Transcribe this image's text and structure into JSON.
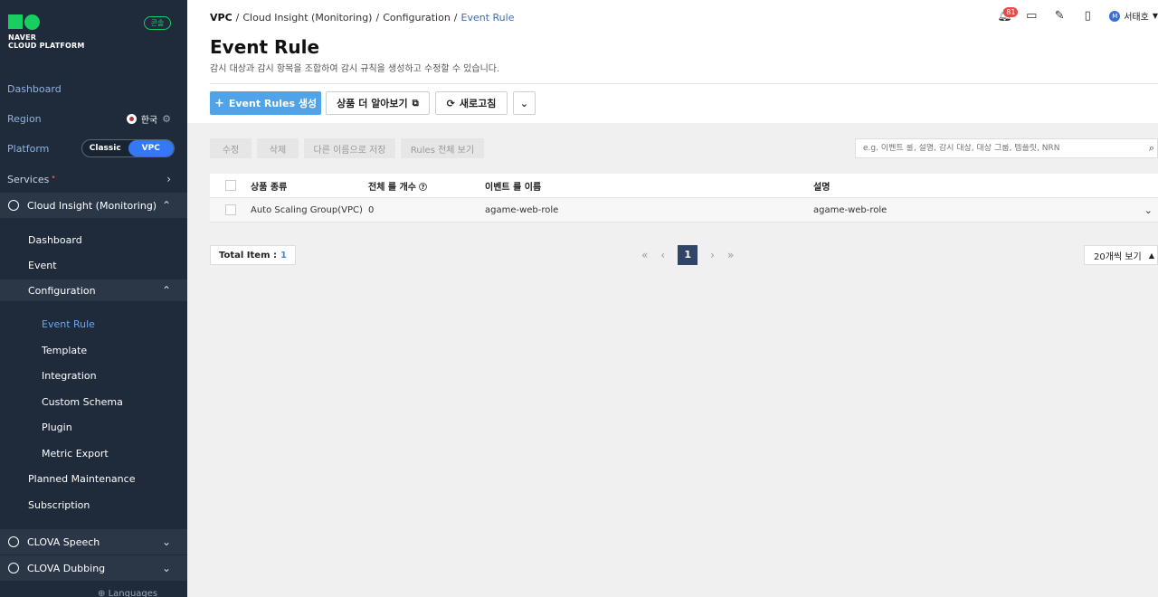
{
  "sidebar": {
    "logo_line1": "NAVER",
    "logo_line2": "CLOUD PLATFORM",
    "console_badge": "콘솔",
    "dashboard": "Dashboard",
    "region_label": "Region",
    "region_value": "한국",
    "platform_label": "Platform",
    "platform_options": [
      "Classic",
      "VPC"
    ],
    "platform_selected": "VPC",
    "services_label": "Services",
    "services_marker": "•",
    "category": "Cloud Insight (Monitoring)",
    "sub_items": [
      "Dashboard",
      "Event",
      "Configuration"
    ],
    "config_items": [
      "Event Rule",
      "Template",
      "Integration",
      "Custom Schema",
      "Plugin",
      "Metric Export"
    ],
    "more_items": [
      "Planned Maintenance",
      "Subscription"
    ],
    "other_categories": [
      "CLOVA Speech",
      "CLOVA Dubbing"
    ],
    "languages": "Languages"
  },
  "header": {
    "breadcrumb": [
      "VPC",
      "Cloud Insight (Monitoring)",
      "Configuration",
      "Event Rule"
    ],
    "title": "Event Rule",
    "description": "감시 대상과 감시 항목을 조합하여 감시 규칙을 생성하고 수정할 수 있습니다.",
    "notification_count": "81",
    "user_initial": "M",
    "user_name": "서태호"
  },
  "actions": {
    "create": "Event Rules 생성",
    "learn_more": "상품 더 알아보기",
    "refresh": "새로고침"
  },
  "toolbar": {
    "edit": "수정",
    "delete": "삭제",
    "save_as": "다른 이름으로 저장",
    "view_all": "Rules 전체 보기",
    "search_placeholder": "e.g. 이벤트 룰, 설명, 감시 대상, 대상 그룹, 템플릿, NRN"
  },
  "table": {
    "headers": [
      "상품 종류",
      "전체 룰 개수",
      "이벤트 룰 이름",
      "설명"
    ],
    "rows": [
      {
        "product": "Auto Scaling Group(VPC)",
        "count": "0",
        "name": "agame-web-role",
        "desc": "agame-web-role"
      }
    ]
  },
  "footer": {
    "total_label": "Total Item :",
    "total_value": "1",
    "current_page": "1",
    "per_page": "20개씩 보기"
  },
  "colors": {
    "sidebar_bg": "#1f2a3a",
    "accent": "#3478f6",
    "brand_green": "#19ce60",
    "primary_button": "#4fa3e8",
    "page_active": "#2f4467"
  }
}
